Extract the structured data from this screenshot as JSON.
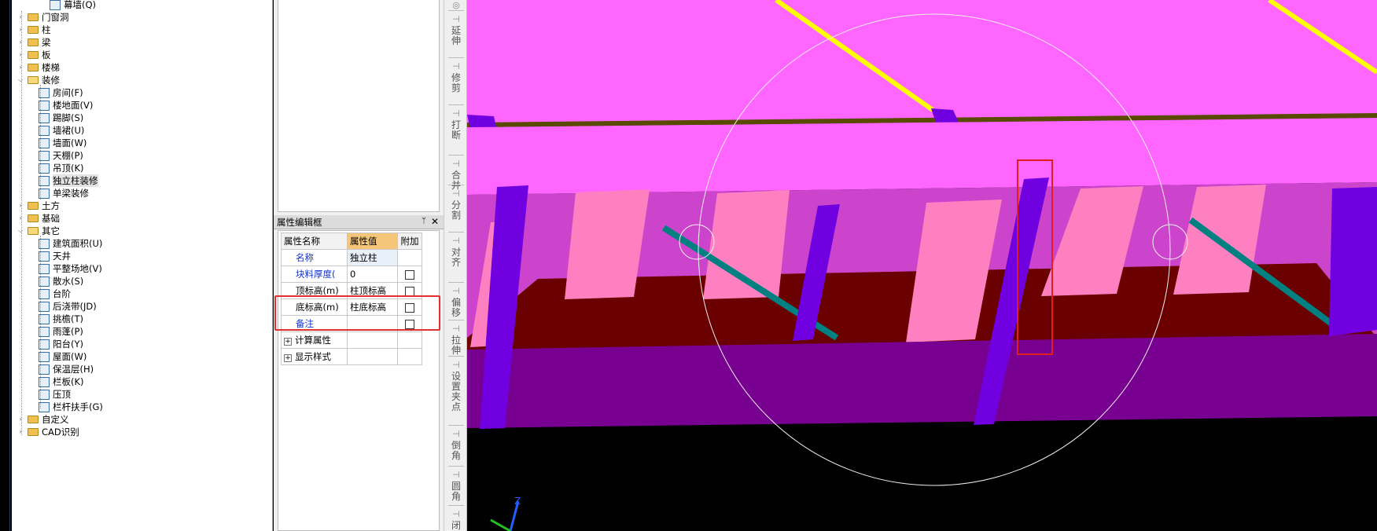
{
  "tree": {
    "items": [
      {
        "label": "幕墙(Q)",
        "level": 2,
        "type": "item",
        "icon": "curtain-wall-icon"
      },
      {
        "label": "门窗洞",
        "level": 0,
        "type": "folder",
        "expanded": false
      },
      {
        "label": "柱",
        "level": 0,
        "type": "folder",
        "expanded": false
      },
      {
        "label": "梁",
        "level": 0,
        "type": "folder",
        "expanded": false
      },
      {
        "label": "板",
        "level": 0,
        "type": "folder",
        "expanded": false
      },
      {
        "label": "楼梯",
        "level": 0,
        "type": "folder",
        "expanded": false
      },
      {
        "label": "装修",
        "level": 0,
        "type": "folder",
        "expanded": true
      },
      {
        "label": "房间(F)",
        "level": 1,
        "type": "item",
        "icon": "room-icon"
      },
      {
        "label": "楼地面(V)",
        "level": 1,
        "type": "item",
        "icon": "floor-icon"
      },
      {
        "label": "踢脚(S)",
        "level": 1,
        "type": "item",
        "icon": "skirting-icon"
      },
      {
        "label": "墙裙(U)",
        "level": 1,
        "type": "item",
        "icon": "dado-icon"
      },
      {
        "label": "墙面(W)",
        "level": 1,
        "type": "item",
        "icon": "wall-face-icon"
      },
      {
        "label": "天棚(P)",
        "level": 1,
        "type": "item",
        "icon": "ceiling-icon"
      },
      {
        "label": "吊顶(K)",
        "level": 1,
        "type": "item",
        "icon": "suspended-ceiling-icon"
      },
      {
        "label": "独立柱装修",
        "level": 1,
        "type": "item",
        "icon": "column-finish-icon",
        "selected": true
      },
      {
        "label": "单梁装修",
        "level": 1,
        "type": "item",
        "icon": "beam-finish-icon"
      },
      {
        "label": "土方",
        "level": 0,
        "type": "folder",
        "expanded": false
      },
      {
        "label": "基础",
        "level": 0,
        "type": "folder",
        "expanded": false
      },
      {
        "label": "其它",
        "level": 0,
        "type": "folder",
        "expanded": true
      },
      {
        "label": "建筑面积(U)",
        "level": 1,
        "type": "item",
        "icon": "building-area-icon"
      },
      {
        "label": "天井",
        "level": 1,
        "type": "item",
        "icon": "patio-icon"
      },
      {
        "label": "平整场地(V)",
        "level": 1,
        "type": "item",
        "icon": "site-leveling-icon"
      },
      {
        "label": "散水(S)",
        "level": 1,
        "type": "item",
        "icon": "apron-icon"
      },
      {
        "label": "台阶",
        "level": 1,
        "type": "item",
        "icon": "steps-icon"
      },
      {
        "label": "后浇带(JD)",
        "level": 1,
        "type": "item",
        "icon": "post-pour-strip-icon"
      },
      {
        "label": "挑檐(T)",
        "level": 1,
        "type": "item",
        "icon": "eave-icon"
      },
      {
        "label": "雨蓬(P)",
        "level": 1,
        "type": "item",
        "icon": "canopy-icon"
      },
      {
        "label": "阳台(Y)",
        "level": 1,
        "type": "item",
        "icon": "balcony-icon"
      },
      {
        "label": "屋面(W)",
        "level": 1,
        "type": "item",
        "icon": "roof-icon"
      },
      {
        "label": "保温层(H)",
        "level": 1,
        "type": "item",
        "icon": "insulation-icon"
      },
      {
        "label": "栏板(K)",
        "level": 1,
        "type": "item",
        "icon": "parapet-icon"
      },
      {
        "label": "压顶",
        "level": 1,
        "type": "item",
        "icon": "coping-icon"
      },
      {
        "label": "栏杆扶手(G)",
        "level": 1,
        "type": "item",
        "icon": "railing-icon"
      },
      {
        "label": "自定义",
        "level": 0,
        "type": "folder",
        "expanded": false
      },
      {
        "label": "CAD识别",
        "level": 0,
        "type": "folder",
        "expanded": false
      }
    ]
  },
  "properties": {
    "title": "属性编辑框",
    "columns": {
      "name": "属性名称",
      "value": "属性值",
      "extra": "附加"
    },
    "rows": [
      {
        "name": "名称",
        "value": "独立柱",
        "checkbox": false
      },
      {
        "name": "块料厚度(",
        "value": "0",
        "checkbox": true
      },
      {
        "name": "顶标高(m)",
        "value": "柱顶标高",
        "checkbox": true
      },
      {
        "name": "底标高(m)",
        "value": "柱底标高",
        "checkbox": true
      },
      {
        "name": "备注",
        "value": "",
        "checkbox": true
      }
    ],
    "groups": [
      {
        "label": "计算属性"
      },
      {
        "label": "显示样式"
      }
    ]
  },
  "toolbar": {
    "buttons": [
      {
        "label": "延伸",
        "icon": "extend-icon"
      },
      {
        "label": "修剪",
        "icon": "trim-icon"
      },
      {
        "label": "打断",
        "icon": "break-icon"
      },
      {
        "label": "合并",
        "icon": "merge-icon"
      },
      {
        "label": "分割",
        "icon": "split-icon"
      },
      {
        "label": "对齐",
        "icon": "align-icon"
      },
      {
        "label": "偏移",
        "icon": "offset-icon"
      },
      {
        "label": "拉伸",
        "icon": "stretch-icon"
      },
      {
        "label": "设置夹点",
        "icon": "grip-icon"
      },
      {
        "label": "倒角",
        "icon": "chamfer-icon"
      },
      {
        "label": "圆角",
        "icon": "fillet-icon"
      },
      {
        "label": "闭合",
        "icon": "close-shape-icon"
      }
    ]
  },
  "viewport": {
    "axis_label": "Z",
    "colors": {
      "slab": "#ff66ff",
      "beam": "#cc44cc",
      "column": "#7000e0",
      "wall": "#6a0000",
      "window": "#ff80c0",
      "selection": "#e02020"
    }
  }
}
